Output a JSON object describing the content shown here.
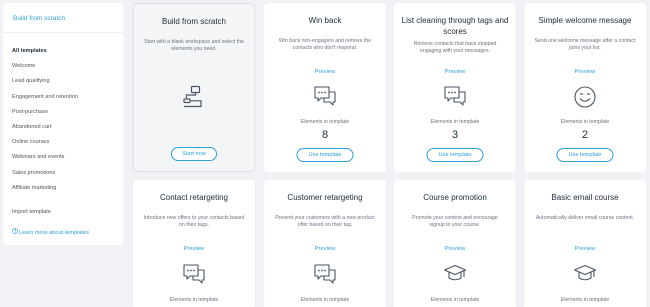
{
  "sidebar": {
    "build_from_scratch": "Build from scratch",
    "items": [
      {
        "label": "All templates",
        "active": true
      },
      {
        "label": "Welcome"
      },
      {
        "label": "Lead qualifying"
      },
      {
        "label": "Engagement and retention"
      },
      {
        "label": "Post-purchase"
      },
      {
        "label": "Abandoned cart"
      },
      {
        "label": "Online courses"
      },
      {
        "label": "Webinars and events"
      },
      {
        "label": "Sales promotions"
      },
      {
        "label": "Affiliate marketing"
      }
    ],
    "import_template": "Import template",
    "learn_more_icon": "question-circle-icon",
    "learn_more": "Learn more about templates"
  },
  "scratch_card": {
    "title": "Build from scratch",
    "description": "Start with a blank workspace and select the elements you need.",
    "icon": "workflow-icon",
    "button": "Start now"
  },
  "templates": [
    {
      "title": "Win back",
      "description": "Win back non-engagers and remove the contacts who don't respond.",
      "preview": "Preview",
      "icon": "chat-bubbles-icon",
      "elements_label": "Elements in template",
      "elements_count": "8",
      "button": "Use template"
    },
    {
      "title": "List cleaning through tags and scores",
      "description": "Remove contacts that have stopped engaging with your messages.",
      "preview": "Preview",
      "icon": "chat-bubbles-icon",
      "elements_label": "Elements in template",
      "elements_count": "3",
      "button": "Use template"
    },
    {
      "title": "Simple welcome message",
      "description": "Send one welcome message after a contact joins your list.",
      "preview": "Preview",
      "icon": "smiley-icon",
      "elements_label": "Elements in template",
      "elements_count": "2",
      "button": "Use template"
    },
    {
      "title": "Contact retargeting",
      "description": "Introduce new offers to your contacts based on their tags.",
      "preview": "Preview",
      "icon": "chat-bubbles-icon",
      "elements_label": "Elements in template"
    },
    {
      "title": "Customer retargeting",
      "description": "Present your customers with a new product offer based on their tag.",
      "preview": "Preview",
      "icon": "chat-bubbles-icon",
      "elements_label": "Elements in template"
    },
    {
      "title": "Course promotion",
      "description": "Promote your content and encourage signup to your course.",
      "preview": "Preview",
      "icon": "graduation-cap-icon",
      "elements_label": "Elements in template"
    },
    {
      "title": "Basic email course",
      "description": "Automatically deliver email course content.",
      "preview": "Preview",
      "icon": "graduation-cap-icon",
      "elements_label": "Elements in template"
    }
  ],
  "colors": {
    "accent": "#2d9fd9",
    "background": "#f0f2f5",
    "title": "#1c2b36",
    "icon_stroke": "#4a5561"
  }
}
